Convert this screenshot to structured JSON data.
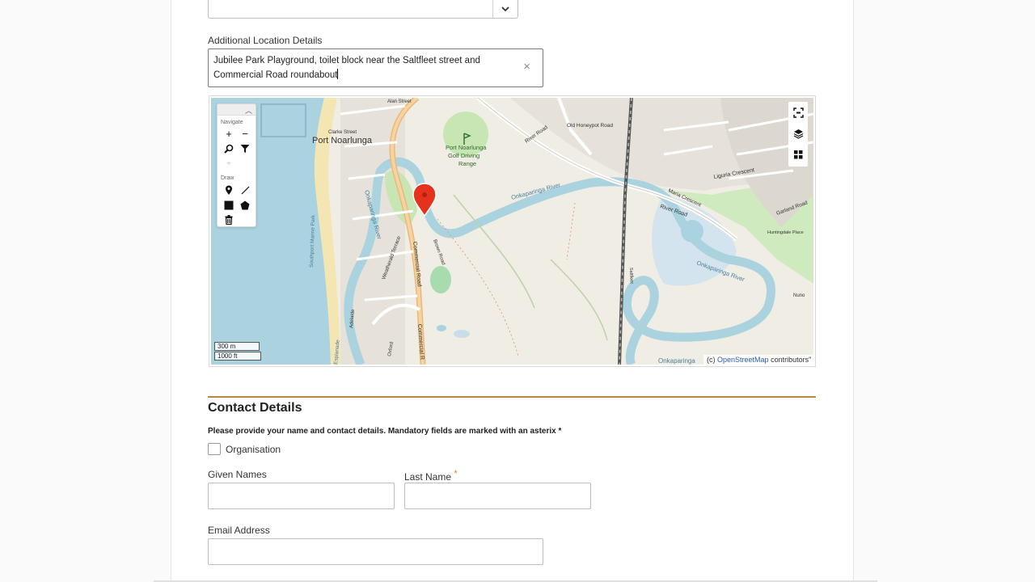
{
  "location_select": {
    "chevron_icon": "chevron-down-icon"
  },
  "additional_location": {
    "label": "Additional Location Details",
    "value_line1": "Jubilee Park Playground, toilet block near the Saltfleet street and",
    "value_line2": "Commercial Road roundabout",
    "clear_icon": "×"
  },
  "map": {
    "navigate_label": "Navigate",
    "draw_label": "Draw",
    "place_labels": {
      "port_noarlunga": "Port Noarlunga",
      "golf_line1": "Port Noarlunga",
      "golf_line2": "Golf Driving",
      "golf_line3": "Range",
      "river": "Onkaparinga River",
      "river2": "Onkaparinga River",
      "river3": "Onkaparinga",
      "commercial_road": "Commercial Road",
      "commercial_road2": "Commercial R",
      "river_road": "River Road",
      "old_honeypot": "Old Honeypot Road",
      "clarke": "Clarke Street",
      "alan": "Alan Street",
      "weatherald": "Weatherald Terrace",
      "esplanade": "Esplanade",
      "marine": "Southport Marine Park",
      "liguria": "Liguria Crescent",
      "garland": "Garland Road",
      "maria": "Maria Crescent",
      "brown": "Brown Road",
      "huntingdale": "Huntingdale Place",
      "nuno": "Nuno",
      "saltfleet": "Saltfleet",
      "oxford": "Oxford",
      "adelaide": "Adelaide"
    },
    "scale_metric": "300 m",
    "scale_imperial": "1000 ft",
    "attribution_prefix": "(c)",
    "attribution_link": "OpenStreetMap",
    "attribution_suffix": "contributors\""
  },
  "contact": {
    "title": "Contact Details",
    "instructions": "Please provide your name and contact details. Mandatory fields are marked with an asterix *",
    "organisation_label": "Organisation",
    "given_names_label": "Given Names",
    "last_name_label": "Last Name",
    "required_marker": "*",
    "email_label": "Email Address"
  },
  "colors": {
    "accent_rule": "#b58a38",
    "required": "#d9822b",
    "water": "#aad3df",
    "park": "#c8e6b4",
    "marker": "#e5321e"
  }
}
